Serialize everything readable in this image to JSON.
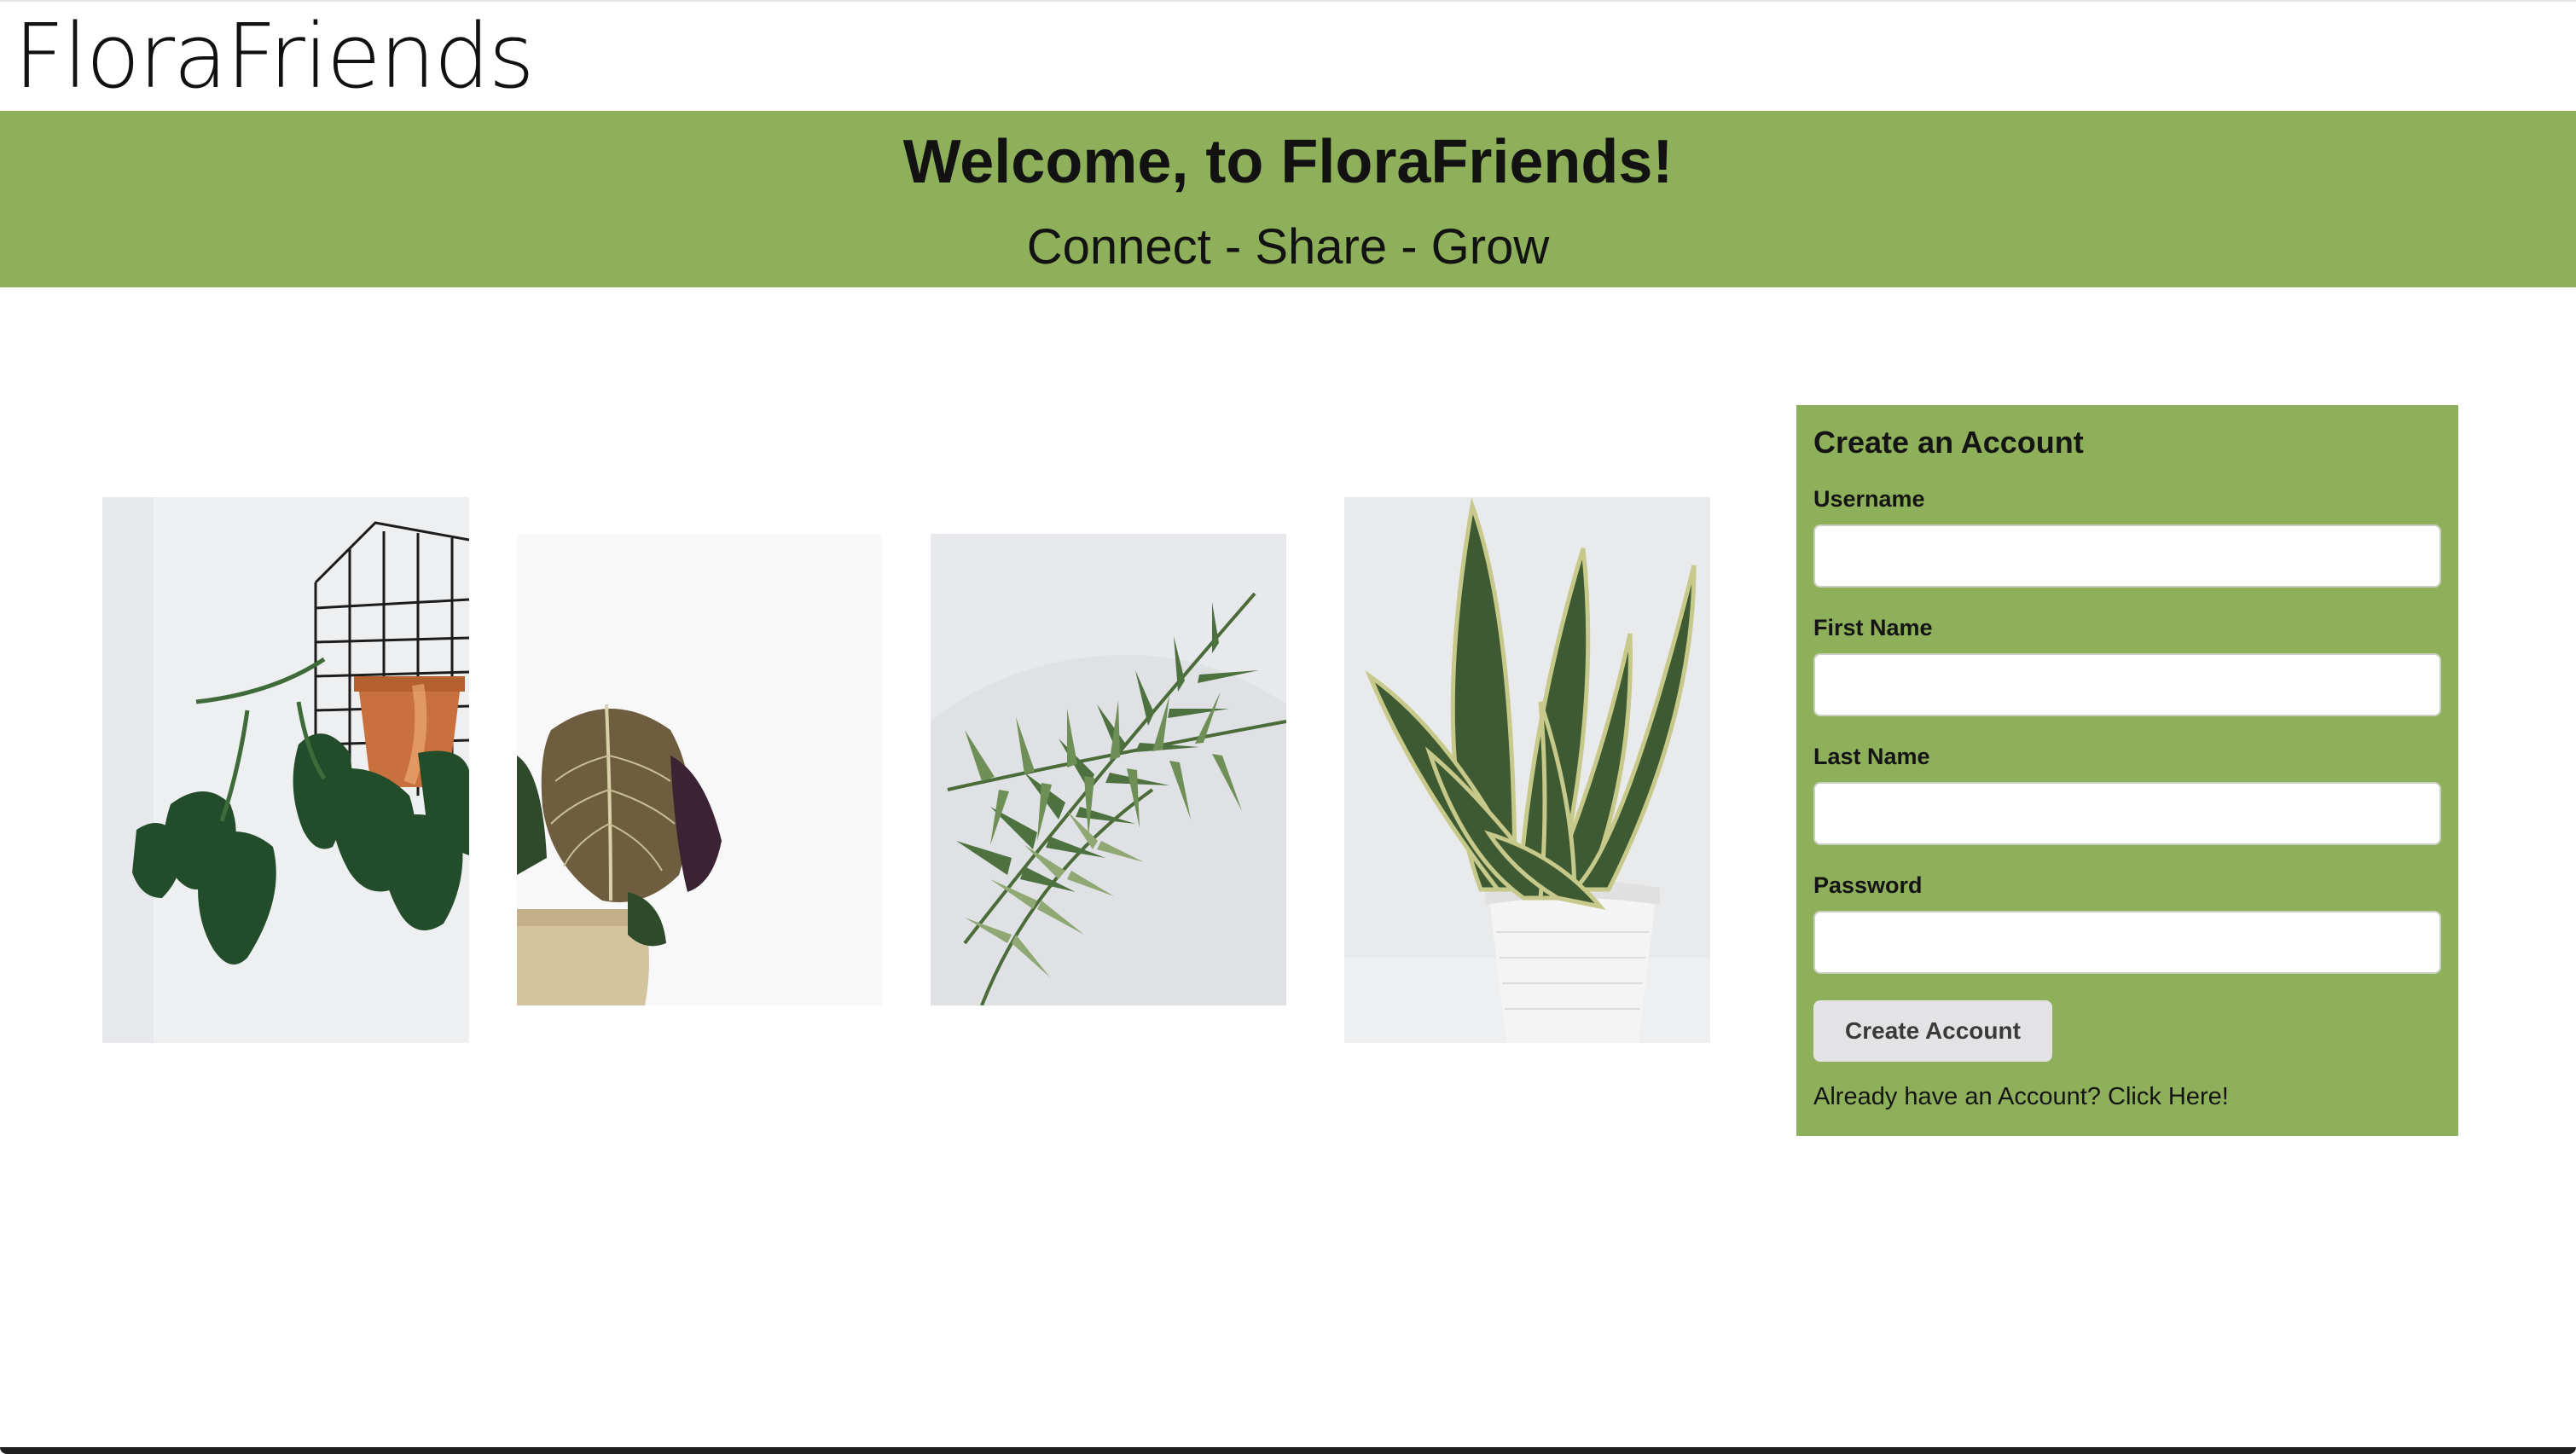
{
  "header": {
    "logo_text": "FloraFriends"
  },
  "hero": {
    "title": "Welcome, to FloraFriends!",
    "tagline": "Connect - Share - Grow",
    "background_color": "#8fb05a"
  },
  "gallery": {
    "images": [
      {
        "subject": "monstera plant hanging from wire rack with terracotta pot"
      },
      {
        "subject": "alocasia plant in beige pot"
      },
      {
        "subject": "parlor palm fronds"
      },
      {
        "subject": "snake plant in white pot"
      }
    ]
  },
  "signup": {
    "title": "Create an Account",
    "fields": [
      {
        "label": "Username",
        "value": "",
        "placeholder": ""
      },
      {
        "label": "First Name",
        "value": "",
        "placeholder": ""
      },
      {
        "label": "Last Name",
        "value": "",
        "placeholder": ""
      },
      {
        "label": "Password",
        "value": "",
        "placeholder": ""
      }
    ],
    "submit_label": "Create Account",
    "login_link": "Already have an Account? Click Here!",
    "panel_color": "#8fb05a"
  }
}
